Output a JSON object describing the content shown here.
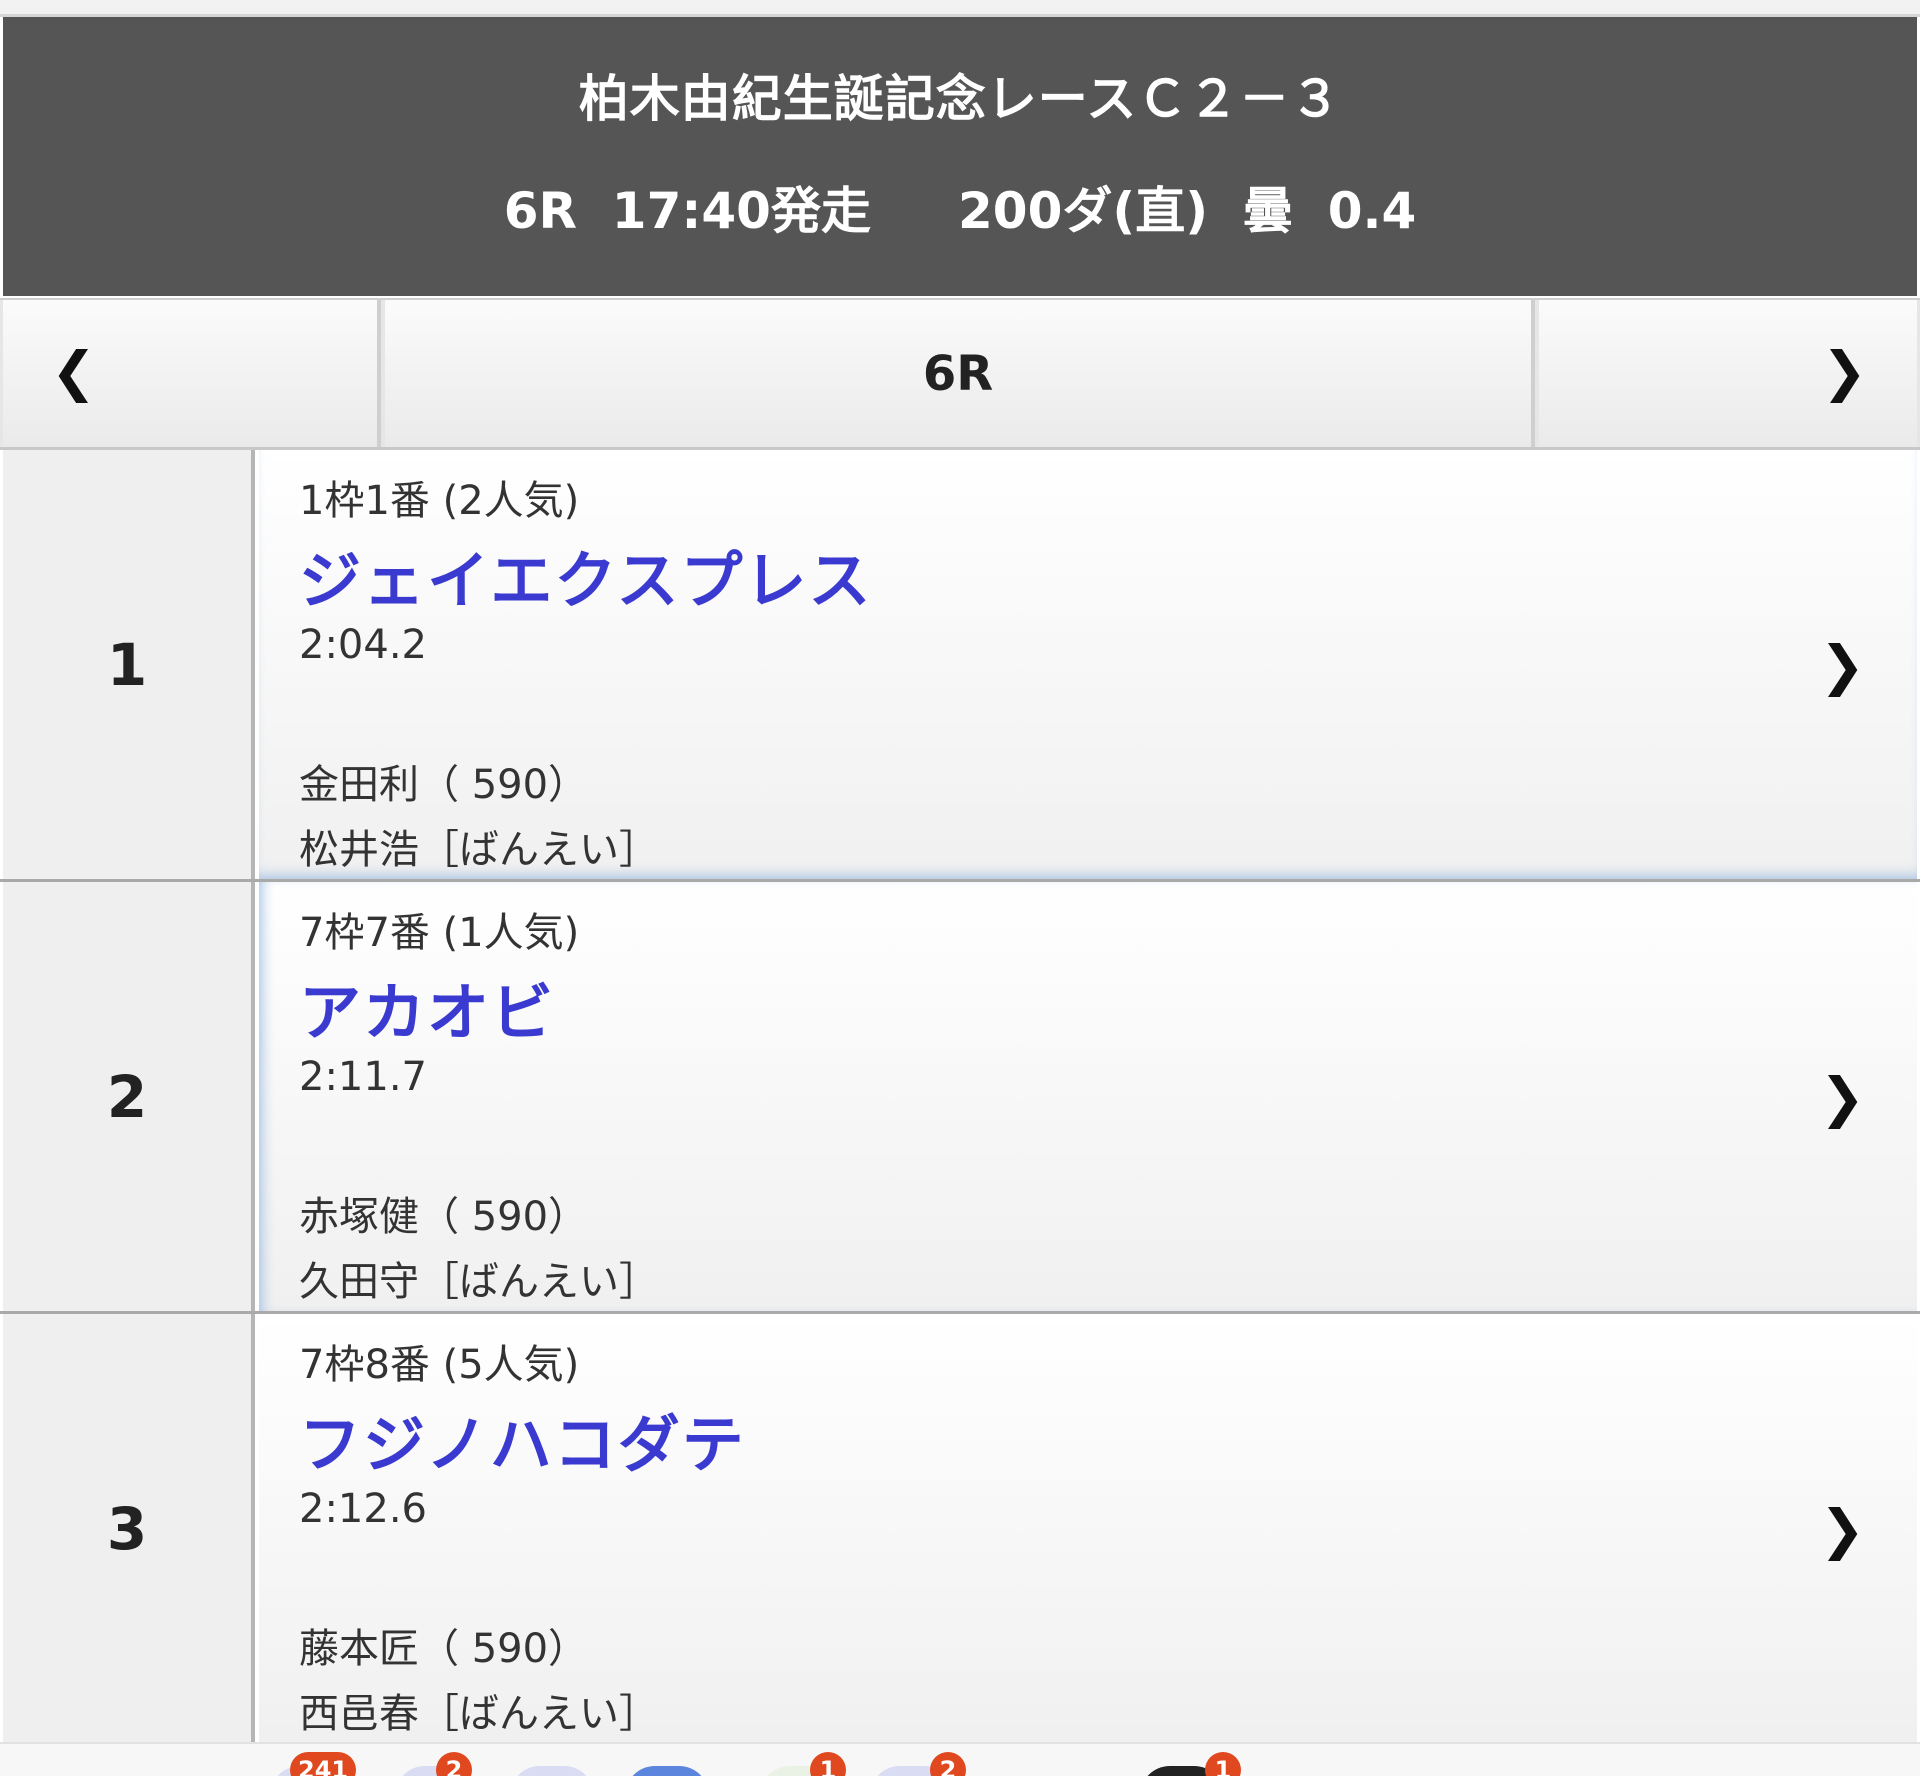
{
  "race": {
    "title": "柏木由紀生誕記念レースＣ２－３",
    "info_line": "6R  17:40発走     200ダ(直)  曇  0.4"
  },
  "nav": {
    "prev_icon": "chevron-left-icon",
    "current_label": "6R",
    "next_icon": "chevron-right-icon"
  },
  "results": [
    {
      "rank": "1",
      "post_position": "1枠1番 (2人気)",
      "horse_name": "ジェイエクスプレス",
      "time": "2:04.2",
      "jockey": "金田利（ 590）",
      "trainer": "松井浩［ばんえい］"
    },
    {
      "rank": "2",
      "post_position": "7枠7番 (1人気)",
      "horse_name": "アカオビ",
      "time": "2:11.7",
      "jockey": "赤塚健（ 590）",
      "trainer": "久田守［ばんえい］"
    },
    {
      "rank": "3",
      "post_position": "7枠8番 (5人気)",
      "horse_name": "フジノハコダテ",
      "time": "2:12.6",
      "jockey": "藤本匠（ 590）",
      "trainer": "西邑春［ばんえい］"
    }
  ],
  "colors": {
    "header_bg": "#555555",
    "horse_name": "#3a3ad0",
    "badge": "#e0491f"
  },
  "dock": {
    "badges": [
      "241",
      "2",
      "1",
      "2",
      "1"
    ]
  }
}
